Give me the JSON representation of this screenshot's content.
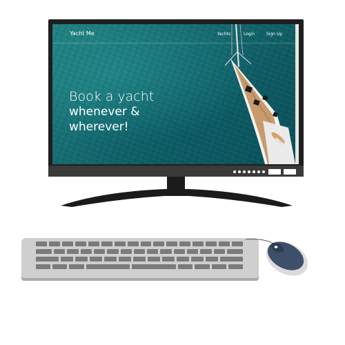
{
  "website": {
    "brand": "Yacht Me",
    "nav": {
      "yachts": "Yachts",
      "login": "Login",
      "signup": "Sign Up"
    },
    "hero": {
      "line1": "Book a yacht",
      "line2": "whenever &",
      "line3": "wherever!"
    }
  },
  "colors": {
    "water": "#146a70",
    "monitor": "#1f1f1f",
    "keyboard": "#cfcfcf",
    "keys": "#7a7a7a",
    "mouse": "#3e5069"
  },
  "icons": {
    "monitor": "monitor-icon",
    "keyboard": "keyboard-icon",
    "mouse": "mouse-icon",
    "yacht": "yacht-image"
  }
}
